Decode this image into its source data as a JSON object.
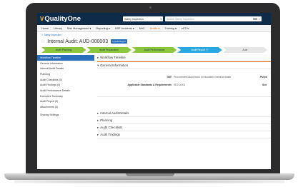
{
  "app": {
    "logo_mark": "∨",
    "logo_text": "QualityOne",
    "module_select": "Safety Inspection",
    "search_placeholder": "Search Safety Inspection",
    "search_icon_1": "⌨",
    "search_icon_2": "⌕"
  },
  "menu": [
    "Home",
    "Library",
    "Risk Management ▾",
    "Reporting ▾",
    "HSE Incidents ▾",
    "MoC",
    "Audits ▾",
    "Training ▾",
    "ePTW"
  ],
  "menu_active_index": 6,
  "breadcrumb": "Safety Inspection",
  "record": {
    "title": "Internal Audit: AUD-000003",
    "badge": "In Audit Report"
  },
  "steps": [
    {
      "label": "Audit Planning",
      "state": "done"
    },
    {
      "label": "Audit Preparation",
      "state": "done"
    },
    {
      "label": "Audit Performance",
      "state": "done"
    },
    {
      "label": "Audit Report",
      "state": "current"
    },
    {
      "label": "Audi",
      "state": "next"
    }
  ],
  "step_info_icon": "ⓘ",
  "sidenav": [
    "Workflow Timeline",
    "General Information",
    "Internal Audit Details",
    "Planning",
    "Audit Checklists (0)",
    "Audit Findings (0)",
    "Audit Performance Details",
    "Executive Summary",
    "Audit Report (0)",
    "Attachments (0)",
    "",
    "Sharing Settings"
  ],
  "sections": {
    "workflow": "Workflow Timeline",
    "general": "General Information",
    "internal": "Internal Audit Details",
    "planning": "Planning",
    "checklists": "Audit Checklists",
    "findings": "Audit Findings"
  },
  "fields": {
    "title_label": "Title",
    "title_value": "Procurement Audit focus on bloodline chemical waste",
    "standards_label": "Applicable Standards & Requirements",
    "standards_value": "ISO 14001",
    "purpose_label": "Purpo",
    "scope_label": "Sco"
  },
  "colors": {
    "topbar": "#0e2b4a",
    "accent": "#e8731a",
    "step_done": "#8cc63f",
    "step_current": "#29a8e0",
    "nav_active": "#2a6ebb"
  }
}
